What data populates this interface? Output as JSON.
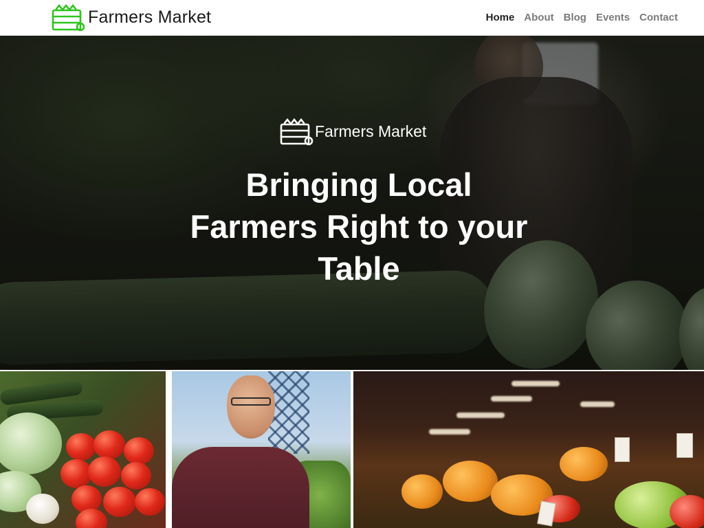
{
  "header": {
    "brand_name": "Farmers Market",
    "logo_icon": "vegetable-crate-icon",
    "logo_color": "#2ec41c",
    "nav": [
      {
        "label": "Home",
        "active": true
      },
      {
        "label": "About",
        "active": false
      },
      {
        "label": "Blog",
        "active": false
      },
      {
        "label": "Events",
        "active": false
      },
      {
        "label": "Contact",
        "active": false
      }
    ]
  },
  "hero": {
    "brand_name": "Farmers Market",
    "logo_icon": "vegetable-crate-icon",
    "title": "Bringing Local Farmers Right to your Table",
    "image": "blurred-farmer-with-melons-photo"
  },
  "gallery": [
    {
      "image": "vegetable-stall-photo"
    },
    {
      "image": "farmer-portrait-photo"
    },
    {
      "image": "market-produce-aisle-photo"
    }
  ]
}
